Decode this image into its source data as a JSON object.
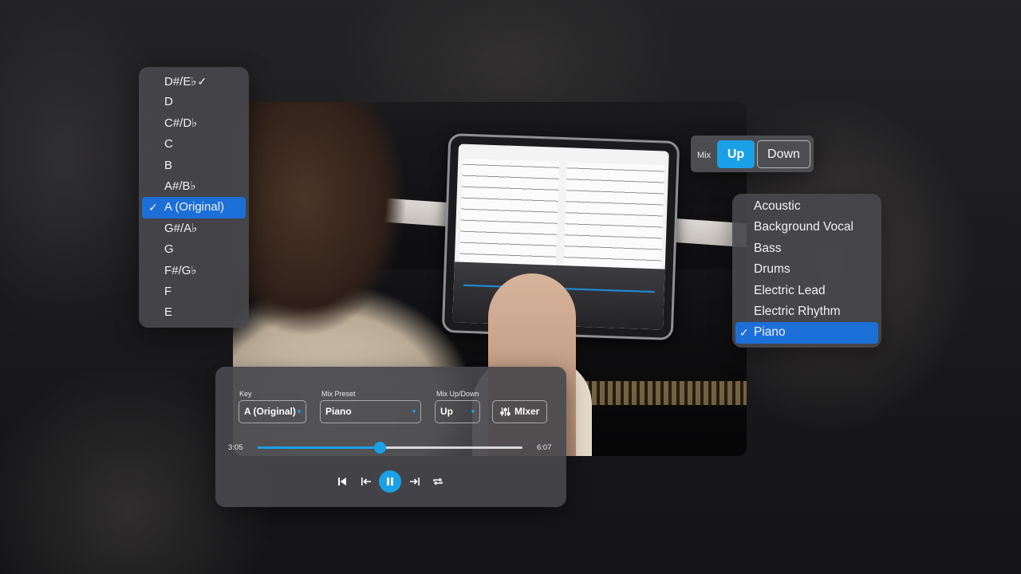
{
  "key_menu": {
    "items": [
      {
        "label": "D#/E♭",
        "selected": false
      },
      {
        "label": "D",
        "selected": false
      },
      {
        "label": "C#/D♭",
        "selected": false
      },
      {
        "label": "C",
        "selected": false
      },
      {
        "label": "B",
        "selected": false
      },
      {
        "label": "A#/B♭",
        "selected": false
      },
      {
        "label": "A (Original)",
        "selected": true
      },
      {
        "label": "G#/A♭",
        "selected": false
      },
      {
        "label": "G",
        "selected": false
      },
      {
        "label": "F#/G♭",
        "selected": false
      },
      {
        "label": "F",
        "selected": false
      },
      {
        "label": "E",
        "selected": false
      }
    ],
    "check": "✓"
  },
  "mix_toggle": {
    "label": "Mix",
    "up": "Up",
    "down": "Down",
    "active": "Up"
  },
  "preset_menu": {
    "items": [
      {
        "label": "Acoustic",
        "selected": false
      },
      {
        "label": "Background Vocal",
        "selected": false
      },
      {
        "label": "Bass",
        "selected": false
      },
      {
        "label": "Drums",
        "selected": false
      },
      {
        "label": "Electric Lead",
        "selected": false
      },
      {
        "label": "Electric Rhythm",
        "selected": false
      },
      {
        "label": "Piano",
        "selected": true
      }
    ],
    "check": "✓"
  },
  "player": {
    "key_label": "Key",
    "key_value": "A (Original)",
    "preset_label": "Mix Preset",
    "preset_value": "Piano",
    "updown_label": "Mix Up/Down",
    "updown_value": "Up",
    "mixer_label": "MIxer",
    "current_time": "3:05",
    "total_time": "6:07",
    "progress": 0.46,
    "accent": "#1aa0e6",
    "icons": [
      "skip-back-icon",
      "back-10-icon",
      "pause-icon",
      "forward-icon",
      "repeat-icon"
    ]
  },
  "colors": {
    "selection": "#1d6fd8",
    "accent": "#1aa0e6"
  }
}
